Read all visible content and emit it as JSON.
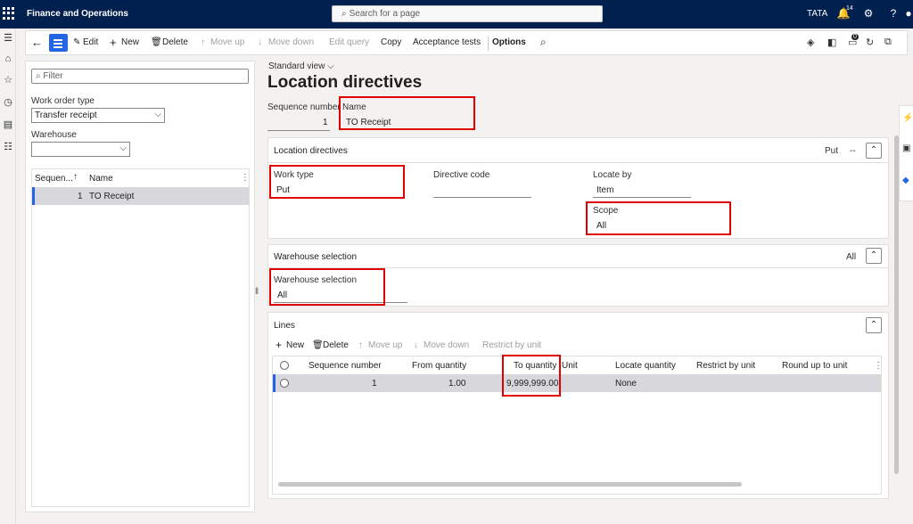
{
  "topbar": {
    "app_title": "Finance and Operations",
    "search_placeholder": "Search for a page",
    "company": "TATA",
    "notification_count": "14"
  },
  "actionbar": {
    "edit": "Edit",
    "new": "New",
    "delete": "Delete",
    "move_up": "Move up",
    "move_down": "Move down",
    "edit_query": "Edit query",
    "copy": "Copy",
    "acceptance_tests": "Acceptance tests",
    "options": "Options",
    "attach_count": "0"
  },
  "leftpane": {
    "filter_placeholder": "Filter",
    "work_order_type_label": "Work order type",
    "work_order_type_value": "Transfer receipt",
    "warehouse_label": "Warehouse",
    "warehouse_value": "",
    "grid": {
      "col_sequence": "Sequen...",
      "col_name": "Name",
      "rows": [
        {
          "sequence": "1",
          "name": "TO Receipt"
        }
      ]
    }
  },
  "main": {
    "view_name": "Standard view",
    "page_title": "Location directives",
    "sequence_label": "Sequence number",
    "sequence_value": "1",
    "name_label": "Name",
    "name_value": "TO Receipt"
  },
  "location_directives": {
    "title": "Location directives",
    "summary_1": "Put",
    "summary_2": "--",
    "work_type_label": "Work type",
    "work_type_value": "Put",
    "directive_code_label": "Directive code",
    "directive_code_value": "",
    "locate_by_label": "Locate by",
    "locate_by_value": "Item",
    "scope_label": "Scope",
    "scope_value": "All"
  },
  "warehouse_selection": {
    "title": "Warehouse selection",
    "summary": "All",
    "field_label": "Warehouse selection",
    "field_value": "All"
  },
  "lines": {
    "title": "Lines",
    "toolbar": {
      "new": "New",
      "delete": "Delete",
      "move_up": "Move up",
      "move_down": "Move down",
      "restrict_by_unit": "Restrict by unit"
    },
    "columns": {
      "sequence_number": "Sequence number",
      "from_quantity": "From quantity",
      "to_quantity": "To quantity",
      "unit": "Unit",
      "locate_quantity": "Locate quantity",
      "restrict_by_unit": "Restrict by unit",
      "round_up_to_unit": "Round up to unit"
    },
    "rows": [
      {
        "sequence_number": "1",
        "from_quantity": "1.00",
        "to_quantity": "9,999,999.00",
        "unit": "",
        "locate_quantity": "None",
        "restrict_by_unit": "",
        "round_up_to_unit": ""
      }
    ]
  },
  "colors": {
    "topbar": "#002050",
    "accent": "#2266e3",
    "highlight_box": "#e00000"
  }
}
